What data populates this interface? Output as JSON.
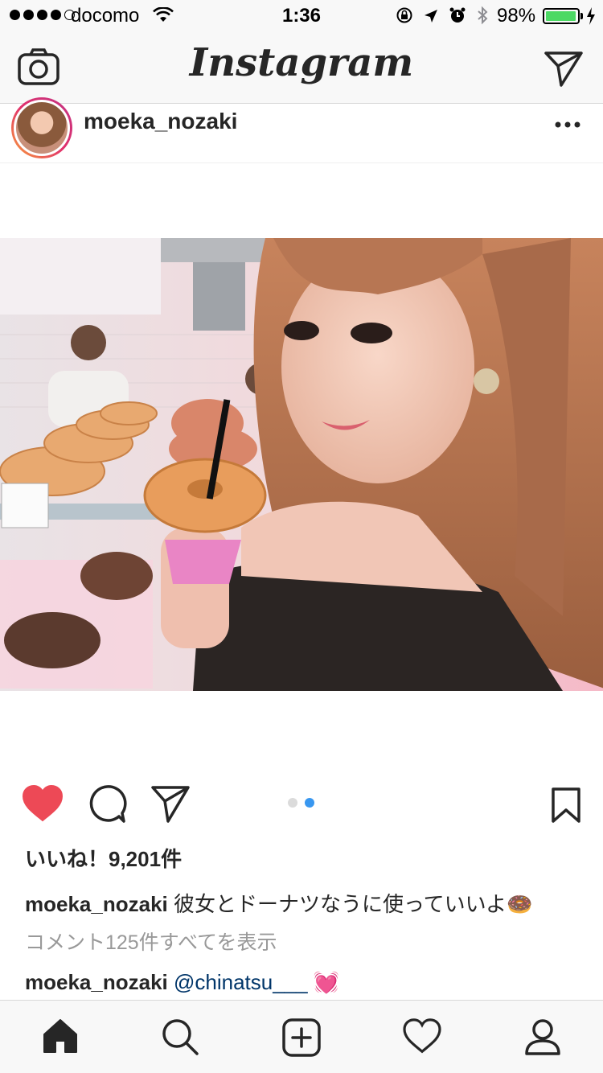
{
  "status_bar": {
    "carrier": "docomo",
    "time": "1:36",
    "battery_percent": "98%",
    "battery_level": 0.98,
    "signal_bars_filled": 4,
    "signal_bars_total": 5
  },
  "navbar": {
    "logo": "Instagram",
    "camera_icon": "camera-icon",
    "direct_icon": "direct-message-icon"
  },
  "post": {
    "username": "moeka_nozaki",
    "more_icon": "more-options-icon",
    "carousel": {
      "count": 2,
      "active_index": 1
    },
    "likes": "いいね！9,201件",
    "caption": {
      "username": "moeka_nozaki",
      "text": "彼女とドーナツなうに使っていいよ🍩"
    },
    "view_comments": "コメント125件すべてを表示",
    "comment": {
      "username": "moeka_nozaki",
      "mention": "@chinatsu___",
      "emoji": "💓"
    },
    "liked": true,
    "colors": {
      "heart": "#ed4956",
      "carousel_active": "#3897f0",
      "mention": "#003569"
    }
  },
  "tabbar": {
    "items": [
      "home-icon",
      "search-icon",
      "add-post-icon",
      "activity-heart-icon",
      "profile-icon"
    ]
  }
}
